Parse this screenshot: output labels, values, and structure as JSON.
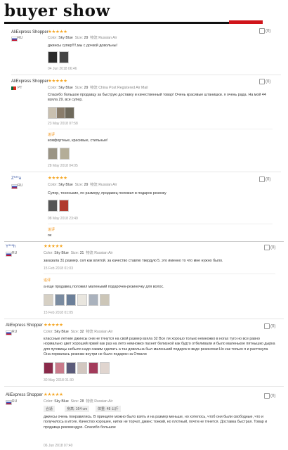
{
  "header": {
    "title": "buyer show"
  },
  "reviews": [
    {
      "name": "AliExpress Shopper",
      "country": "RU",
      "stars": "★★★★★",
      "color_label": "Color:",
      "color": "Sky Blue",
      "size_label": "Size:",
      "size": "29",
      "shipping_label": "物流",
      "shipping": "Russian Air",
      "text": "джинсы супер!!!!,мы с дочкой довольны!",
      "date": "04 Jun 2018 06:46",
      "likes": "(0)"
    },
    {
      "name": "AliExpress Shopper",
      "country": "PT",
      "stars": "★★★★★",
      "color_label": "Color:",
      "color": "Sky Blue",
      "size_label": "Size:",
      "size": "29",
      "shipping_label": "物流",
      "shipping": "China Post Registered Air Mail",
      "text": "Спасибо большое продавцу за быструю доставку и качественный товар! Очень красивые штанишки. я очень рада. На мой 44 взяла 29. все супер.",
      "date": "23 May 2018 07:58",
      "likes": "(0)",
      "additional_label": "追评",
      "additional_text": "комфортные, красивые, стильные!",
      "additional_date": "28 May 2018 04:05"
    },
    {
      "name": "Z***a",
      "country": "RU",
      "stars": "★★★★★",
      "color_label": "Color:",
      "color": "Sky Blue",
      "size_label": "Size:",
      "size": "29",
      "shipping_label": "物流",
      "shipping": "Russian Air",
      "text": "Супер, тоненькие, по размеру, продавец положил в подарок резинку",
      "date": "08 May 2018 23:49",
      "likes": "(0)",
      "additional_label": "追评",
      "additional_text": "ок"
    },
    {
      "name": "Y***h",
      "country": "RU",
      "stars": "★★★★★",
      "color_label": "Color:",
      "color": "Sky Blue",
      "size_label": "Size:",
      "size": "31",
      "shipping_label": "物流",
      "shipping": "Russian Air",
      "text": "заказала 31 размер. сел как влитой. за качество ставлю твердую 5. это именно то что мне нужно было.",
      "date": "15 Feb 2018 01:03",
      "likes": "(0)",
      "additional_label": "追评",
      "additional_text": "а еще продавец положил маленький подарочек-резиночку для волос.",
      "additional_date": "15 Feb 2018 01:05"
    },
    {
      "name": "AliExpress Shopper",
      "country": "RU",
      "stars": "★★★★★",
      "color_label": "Color:",
      "color": "Sky Blue",
      "size_label": "Size:",
      "size": "32",
      "shipping_label": "物流",
      "shipping": "Russian Air",
      "text": "классные летние джинсы они не тянутся на свой размер взяла 32 Все ли хорошо только немножко в ногах туго но все равно нормально цвет хороший яркий как раз на лето немножко пахнет белизной как будто отбеливали и было маленькое пятнышко дырка для пуговицы небыло надо самим сделать а так довольна был маленький подарок в виде резиночки Но как только я и растянула Она порвалась резинки внутри не было подарок на Отвали",
      "date": "30 May 2018 01:30",
      "likes": "(0)"
    },
    {
      "name": "AliExpress Shopper",
      "country": "RU",
      "stars": "★★★★★",
      "color_label": "Color:",
      "color": "Sky Blue",
      "size_label": "Size:",
      "size": "28",
      "shipping_label": "物流",
      "shipping": "Russian Air",
      "tag1": "身高: 164 cm",
      "tag2": "体重: 48 公斤",
      "tag0": "合适",
      "text": "джинсы очень понравились. В принципе можно было взять и на размер меньше, но хотелось, чтоб они были свободные, что и получилось в итоге. Качество хорошее, нитки не торчат, джинс тонкий, но плотный, почти не тянется. Доставка быстрая. Товар и продавца рекомендую. Спасибо большое",
      "date": "06 Jun 2018 07:40",
      "likes": "(0)"
    }
  ],
  "colors": {
    "star": "#f5a623",
    "accent": "#d0141a",
    "additional": "#f29111"
  },
  "icons": {
    "like": "thumbs-up-icon"
  }
}
